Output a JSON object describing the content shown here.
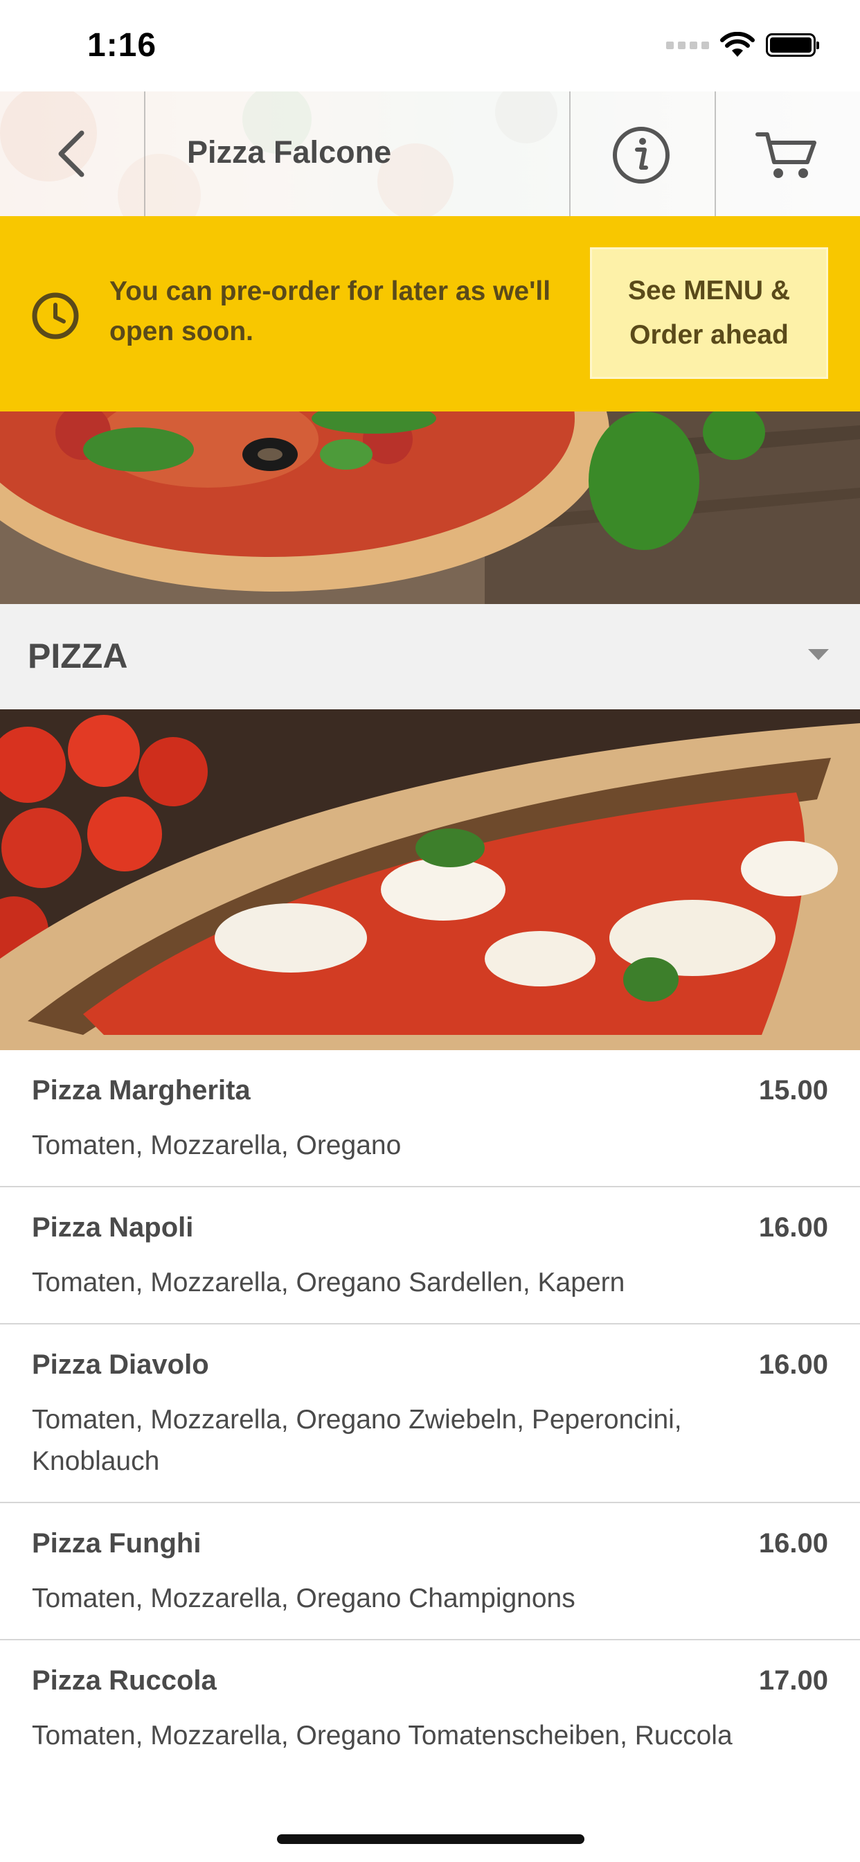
{
  "status_bar": {
    "time": "1:16"
  },
  "navbar": {
    "title": "Pizza Falcone"
  },
  "banner": {
    "message": "You can pre-order for later as we'll open soon.",
    "button_line1": "See MENU &",
    "button_line2": "Order ahead"
  },
  "category": {
    "title": "PIZZA"
  },
  "menu": {
    "items": [
      {
        "name": "Pizza Margherita",
        "price": "15.00",
        "description": "Tomaten, Mozzarella, Oregano"
      },
      {
        "name": "Pizza Napoli",
        "price": "16.00",
        "description": "Tomaten, Mozzarella, Oregano Sardellen, Kapern"
      },
      {
        "name": "Pizza Diavolo",
        "price": "16.00",
        "description": "Tomaten, Mozzarella, Oregano Zwiebeln, Peperoncini, Knoblauch"
      },
      {
        "name": "Pizza Funghi",
        "price": "16.00",
        "description": "Tomaten, Mozzarella, Oregano Champignons"
      },
      {
        "name": "Pizza Ruccola",
        "price": "17.00",
        "description": "Tomaten, Mozzarella, Oregano Tomatenscheiben, Ruccola"
      }
    ]
  },
  "colors": {
    "accent_yellow": "#f8c700",
    "button_light_yellow": "#fdf1a8",
    "text_dark": "#4a4a4a"
  },
  "icons": [
    "back-chevron-icon",
    "info-icon",
    "cart-icon",
    "clock-icon",
    "dropdown-caret-icon",
    "wifi-icon",
    "battery-icon",
    "cellular-signal-icon"
  ]
}
